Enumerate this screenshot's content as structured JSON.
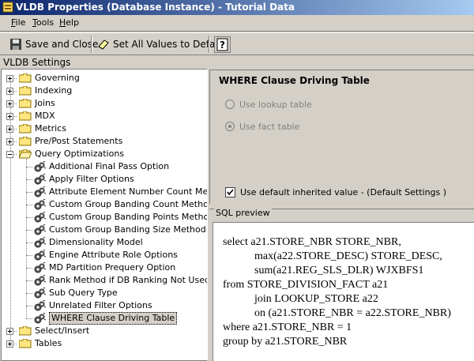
{
  "window": {
    "title": "VLDB Properties (Database Instance) - Tutorial Data"
  },
  "menu": [
    {
      "u": "F",
      "rest": "ile"
    },
    {
      "u": "T",
      "rest": "ools"
    },
    {
      "u": "H",
      "rest": "elp"
    }
  ],
  "toolbar": {
    "save_close": "Save and Close",
    "set_default": "Set All Values to Default",
    "help": "?"
  },
  "section_label": "VLDB Settings",
  "tree": {
    "top_folders": [
      "Governing",
      "Indexing",
      "Joins",
      "MDX",
      "Metrics",
      "Pre/Post Statements"
    ],
    "expanded_folder": "Query Optimizations",
    "children": [
      "Additional Final Pass Option",
      "Apply Filter Options",
      "Attribute Element Number Count Method",
      "Custom Group Banding Count Method",
      "Custom Group Banding Points Method",
      "Custom Group Banding Size Method",
      "Dimensionality Model",
      "Engine Attribute Role Options",
      "MD Partition Prequery Option",
      "Rank Method if DB Ranking Not Used",
      "Sub Query Type",
      "Unrelated Filter Options",
      "WHERE Clause Driving Table"
    ],
    "bottom_folders": [
      "Select/Insert",
      "Tables"
    ]
  },
  "setting": {
    "heading": "WHERE Clause Driving Table",
    "option1": "Use lookup table",
    "option2": "Use fact table",
    "default_check": "Use default inherited value - (Default Settings )"
  },
  "sql": {
    "legend": "SQL preview",
    "lines": [
      "select a21.STORE_NBR STORE_NBR,",
      "max(a22.STORE_DESC) STORE_DESC,",
      "sum(a21.REG_SLS_DLR) WJXBFS1",
      "from STORE_DIVISION_FACT a21",
      "join LOOKUP_STORE a22",
      "on (a21.STORE_NBR = a22.STORE_NBR)",
      "where a21.STORE_NBR = 1",
      "group by a21.STORE_NBR"
    ]
  }
}
